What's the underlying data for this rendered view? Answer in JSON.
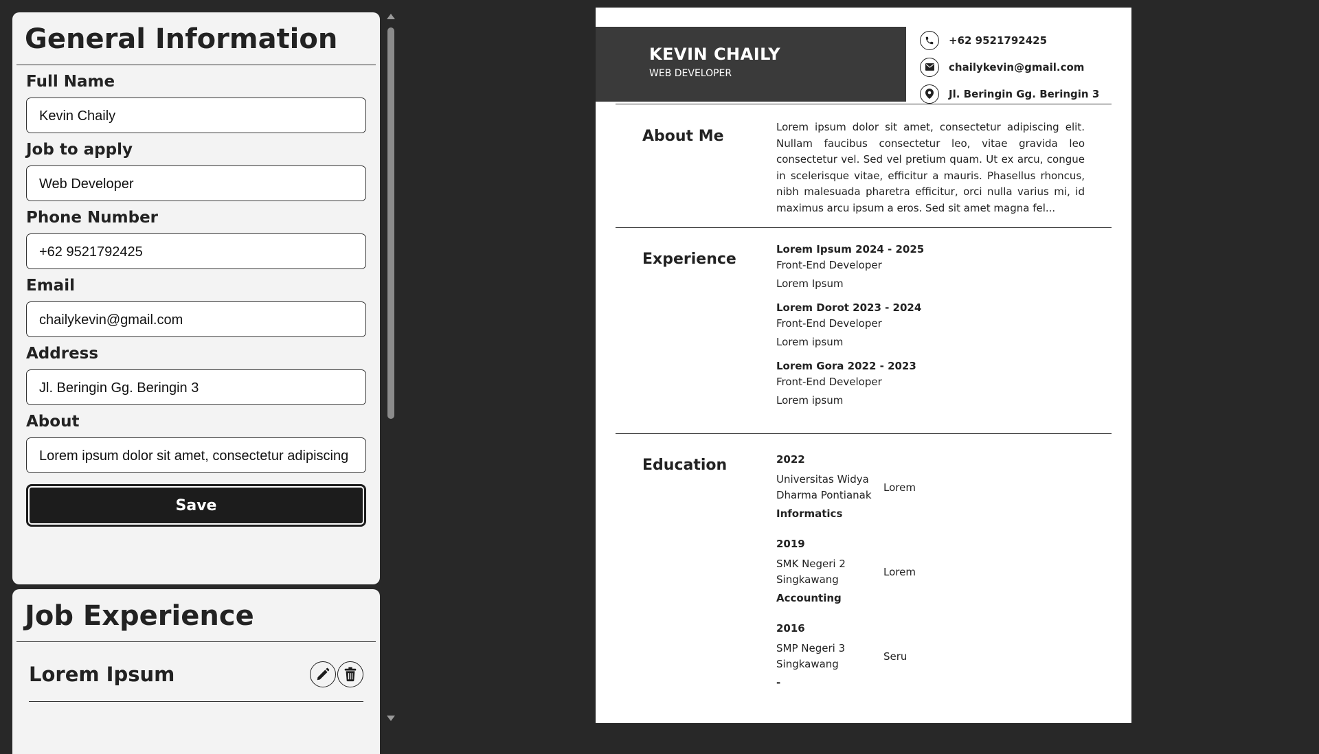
{
  "editor": {
    "general": {
      "title": "General Information",
      "fields": [
        {
          "label": "Full Name",
          "value": "Kevin Chaily"
        },
        {
          "label": "Job to apply",
          "value": "Web Developer"
        },
        {
          "label": "Phone Number",
          "value": "+62 9521792425"
        },
        {
          "label": "Email",
          "value": "chailykevin@gmail.com"
        },
        {
          "label": "Address",
          "value": "Jl. Beringin Gg. Beringin 3"
        },
        {
          "label": "About",
          "value": "Lorem ipsum dolor sit amet, consectetur adipiscing"
        }
      ],
      "save_label": "Save"
    },
    "jobs": {
      "title": "Job Experience",
      "items": [
        {
          "title": "Lorem Ipsum",
          "edit_icon": "pencil-icon",
          "delete_icon": "trash-icon"
        }
      ]
    }
  },
  "resume": {
    "name": "KEVIN CHAILY",
    "job": "WEB DEVELOPER",
    "contacts": {
      "phone": "+62 9521792425",
      "email": "chailykevin@gmail.com",
      "address": "Jl. Beringin Gg. Beringin 3"
    },
    "about": {
      "title": "About Me",
      "text": "Lorem ipsum dolor sit amet, consectetur adipiscing elit. Nullam faucibus consectetur leo, vitae gravida leo consectetur vel. Sed vel pretium quam. Ut ex arcu, congue in scelerisque vitae, efficitur a mauris. Phasellus rhoncus, nibh malesuada pharetra efficitur, orci nulla varius mi, id maximus arcu ipsum a eros. Sed sit amet magna fel..."
    },
    "experience": {
      "title": "Experience",
      "items": [
        {
          "head": "Lorem Ipsum 2024 - 2025",
          "role": "Front-End Developer",
          "desc": "Lorem Ipsum"
        },
        {
          "head": "Lorem Dorot 2023 - 2024",
          "role": "Front-End Developer",
          "desc": "Lorem ipsum"
        },
        {
          "head": "Lorem Gora 2022 - 2023",
          "role": "Front-End Developer",
          "desc": "Lorem ipsum"
        }
      ]
    },
    "education": {
      "title": "Education",
      "items": [
        {
          "year": "2022",
          "school": "Universitas Widya Dharma Pontianak",
          "grade": "Lorem",
          "major": "Informatics"
        },
        {
          "year": "2019",
          "school": "SMK Negeri 2 Singkawang",
          "grade": "Lorem",
          "major": "Accounting"
        },
        {
          "year": "2016",
          "school": "SMP Negeri 3 Singkawang",
          "grade": "Seru",
          "major": "-"
        }
      ]
    }
  },
  "colors": {
    "background": "#282828",
    "panel": "#f3f3f3",
    "button": "#1c1c1c",
    "resume_header": "#3a3a3a"
  }
}
